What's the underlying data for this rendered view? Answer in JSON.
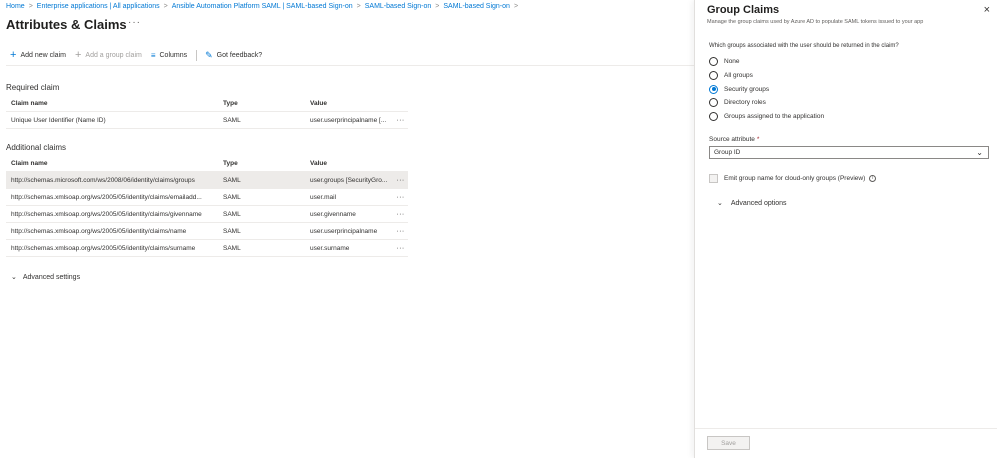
{
  "breadcrumb": [
    "Home",
    "Enterprise applications | All applications",
    "Ansible Automation Platform SAML | SAML-based Sign-on",
    "SAML-based Sign-on",
    "SAML-based Sign-on"
  ],
  "page": {
    "title": "Attributes & Claims",
    "more": "···"
  },
  "toolbar": {
    "add_new_claim": "Add new claim",
    "add_group_claim": "Add a group claim",
    "columns": "Columns",
    "feedback": "Got feedback?"
  },
  "required": {
    "title": "Required claim",
    "headers": {
      "name": "Claim name",
      "type": "Type",
      "value": "Value"
    },
    "rows": [
      {
        "name": "Unique User Identifier (Name ID)",
        "type": "SAML",
        "value": "user.userprincipalname [..."
      }
    ]
  },
  "additional": {
    "title": "Additional claims",
    "headers": {
      "name": "Claim name",
      "type": "Type",
      "value": "Value"
    },
    "rows": [
      {
        "name": "http://schemas.microsoft.com/ws/2008/06/identity/claims/groups",
        "type": "SAML",
        "value": "user.groups [SecurityGro..."
      },
      {
        "name": "http://schemas.xmlsoap.org/ws/2005/05/identity/claims/emailadd...",
        "type": "SAML",
        "value": "user.mail"
      },
      {
        "name": "http://schemas.xmlsoap.org/ws/2005/05/identity/claims/givenname",
        "type": "SAML",
        "value": "user.givenname"
      },
      {
        "name": "http://schemas.xmlsoap.org/ws/2005/05/identity/claims/name",
        "type": "SAML",
        "value": "user.userprincipalname"
      },
      {
        "name": "http://schemas.xmlsoap.org/ws/2005/05/identity/claims/surname",
        "type": "SAML",
        "value": "user.surname"
      }
    ]
  },
  "row_more": "···",
  "advanced_settings": "Advanced settings",
  "panel": {
    "title": "Group Claims",
    "subtitle": "Manage the group claims used by Azure AD to populate SAML tokens issued to your app",
    "close": "×",
    "question": "Which groups associated with the user should be returned in the claim?",
    "options": [
      "None",
      "All groups",
      "Security groups",
      "Directory roles",
      "Groups assigned to the application"
    ],
    "selected_option": "Security groups",
    "source_attribute_label": "Source attribute",
    "source_attribute_required": "*",
    "source_attribute_value": "Group ID",
    "emit_label": "Emit group name for cloud-only groups (Preview)",
    "emit_checked": false,
    "advanced_options": "Advanced options",
    "save_label": "Save"
  },
  "colors": {
    "accent": "#0078d4",
    "selected_row": "#edebe9"
  }
}
